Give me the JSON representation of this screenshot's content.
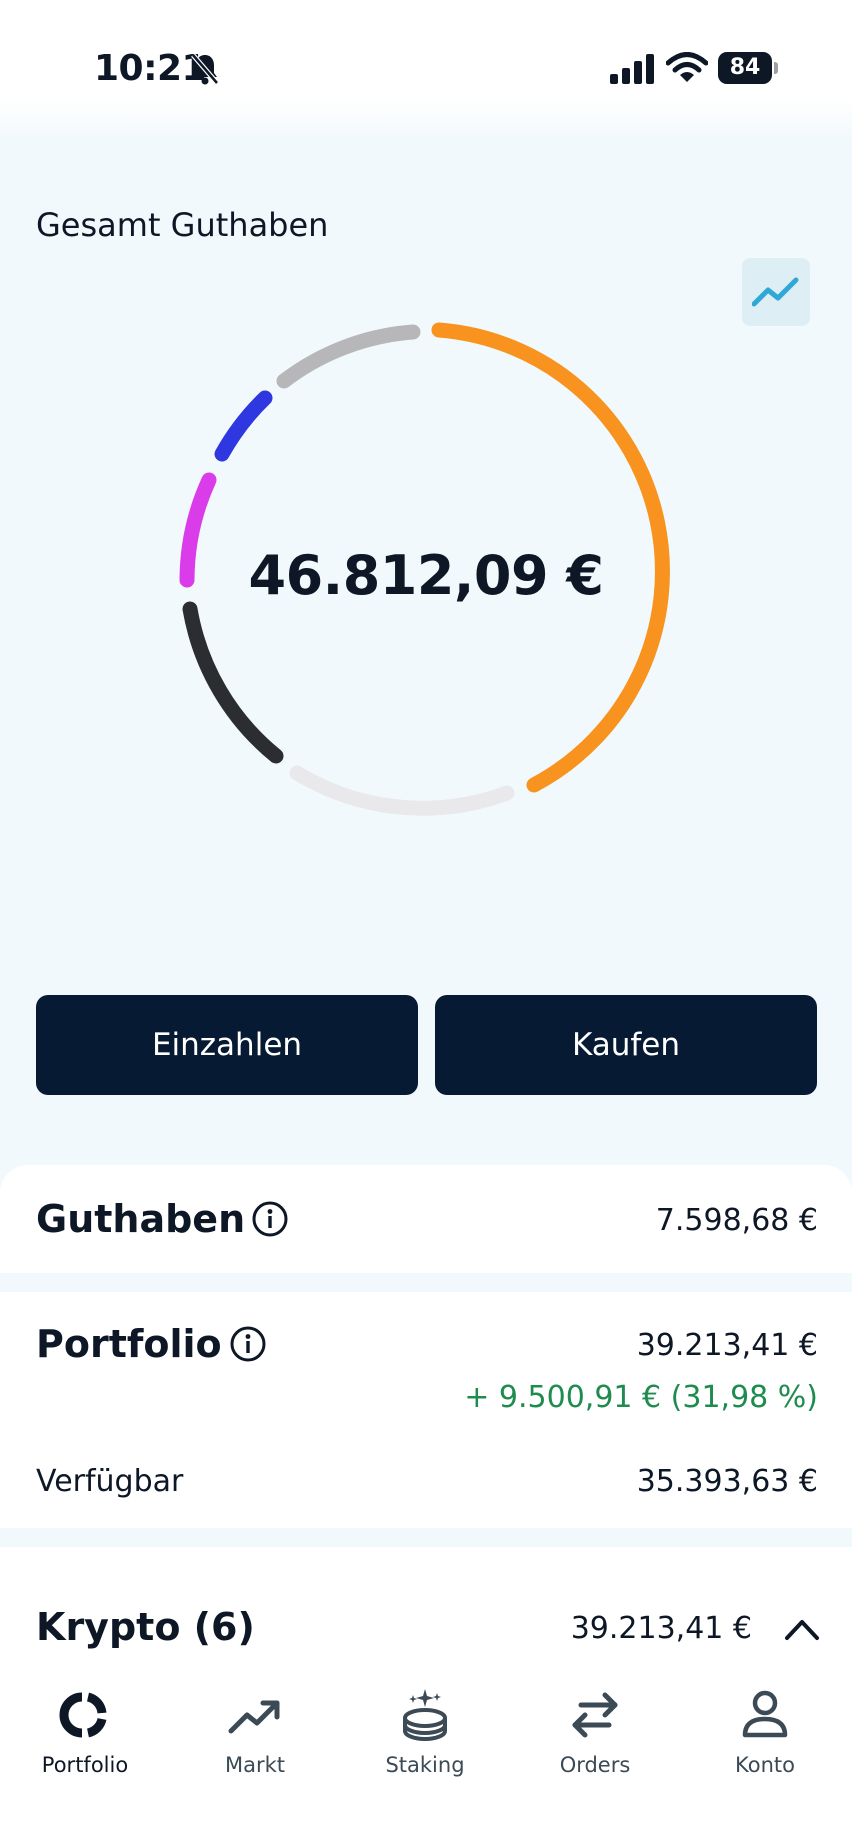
{
  "status_bar": {
    "time": "10:21",
    "battery": "84"
  },
  "balance": {
    "title": "Gesamt Guthaben",
    "total": "46.812,09 €"
  },
  "donut_segments": [
    {
      "name": "orange",
      "color": "#f7931e"
    },
    {
      "name": "lightgray",
      "color": "#e9e9ec"
    },
    {
      "name": "dark",
      "color": "#2b2d31"
    },
    {
      "name": "magenta",
      "color": "#d93ce8"
    },
    {
      "name": "blue",
      "color": "#2f37e0"
    },
    {
      "name": "gray",
      "color": "#b7b7b9"
    }
  ],
  "actions": {
    "deposit_label": "Einzahlen",
    "buy_label": "Kaufen"
  },
  "guthaben": {
    "title": "Guthaben",
    "value": "7.598,68 €"
  },
  "portfolio": {
    "title": "Portfolio",
    "value": "39.213,41 €",
    "gain": "+ 9.500,91 € (31,98 %)",
    "available_label": "Verfügbar",
    "available_value": "35.393,63 €"
  },
  "krypto": {
    "title": "Krypto (6)",
    "value": "39.213,41 €"
  },
  "nav": [
    {
      "label": "Portfolio",
      "icon": "portfolio-icon",
      "active": true
    },
    {
      "label": "Markt",
      "icon": "market-icon"
    },
    {
      "label": "Staking",
      "icon": "staking-icon"
    },
    {
      "label": "Orders",
      "icon": "orders-icon"
    },
    {
      "label": "Konto",
      "icon": "account-icon"
    }
  ],
  "colors": {
    "primary": "#071a33",
    "gain": "#1e8c4e",
    "chart_accent": "#2fa8d8"
  }
}
